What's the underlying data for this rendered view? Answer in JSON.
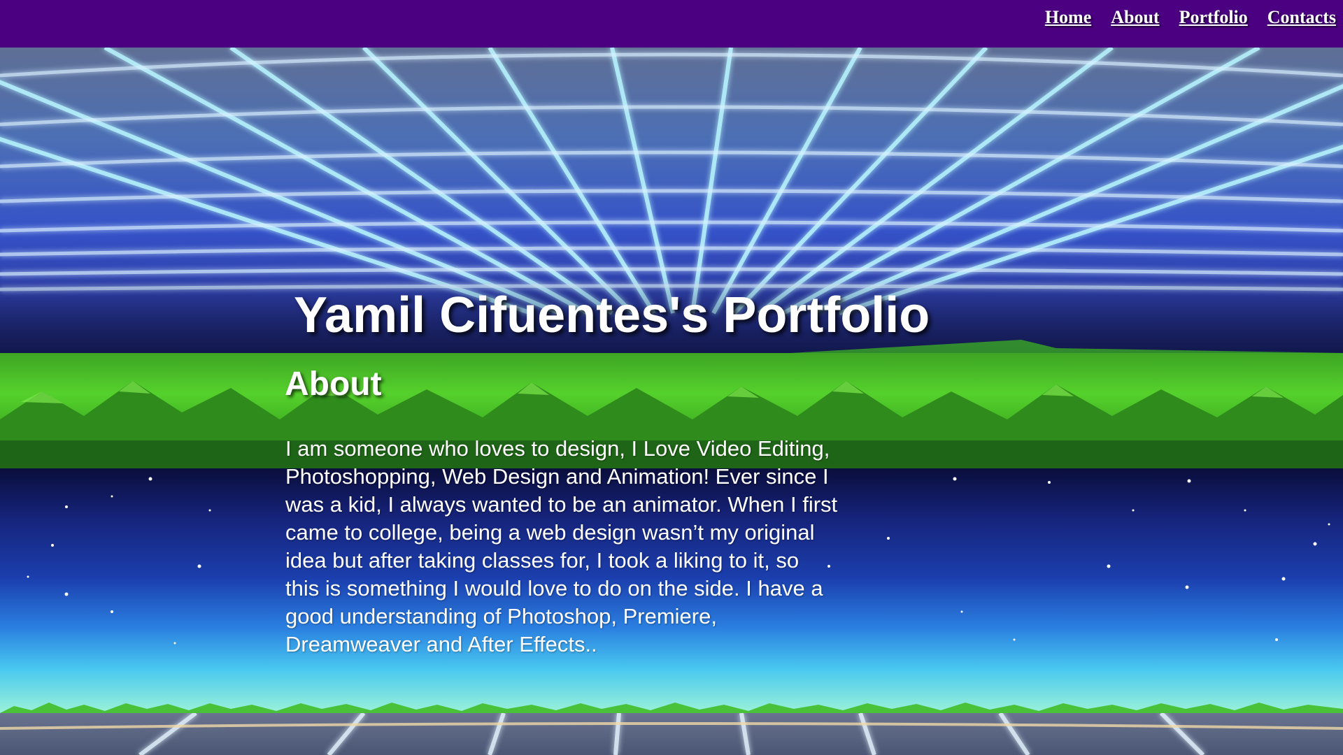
{
  "nav": {
    "items": [
      {
        "label": "Home"
      },
      {
        "label": "About"
      },
      {
        "label": "Portfolio"
      },
      {
        "label": "Contacts"
      }
    ]
  },
  "hero": {
    "title": "Yamil Cifuentes's Portfolio"
  },
  "about": {
    "heading": "About",
    "body": "I am someone who loves to design, I Love Video Editing, Photoshopping, Web Design and Animation! Ever since I was a kid, I always wanted to be an animator. When I first came to college, being a web design wasn’t my original idea but after taking classes for, I took a liking to it, so this is something I would love to do on the side. I have a good understanding of Photoshop, Premiere, Dreamweaver and After Effects.."
  },
  "colors": {
    "navbar": "#4a0080",
    "text": "#ffffff",
    "grid_line": "#a8f4ff",
    "mountain": "#55d12c"
  }
}
